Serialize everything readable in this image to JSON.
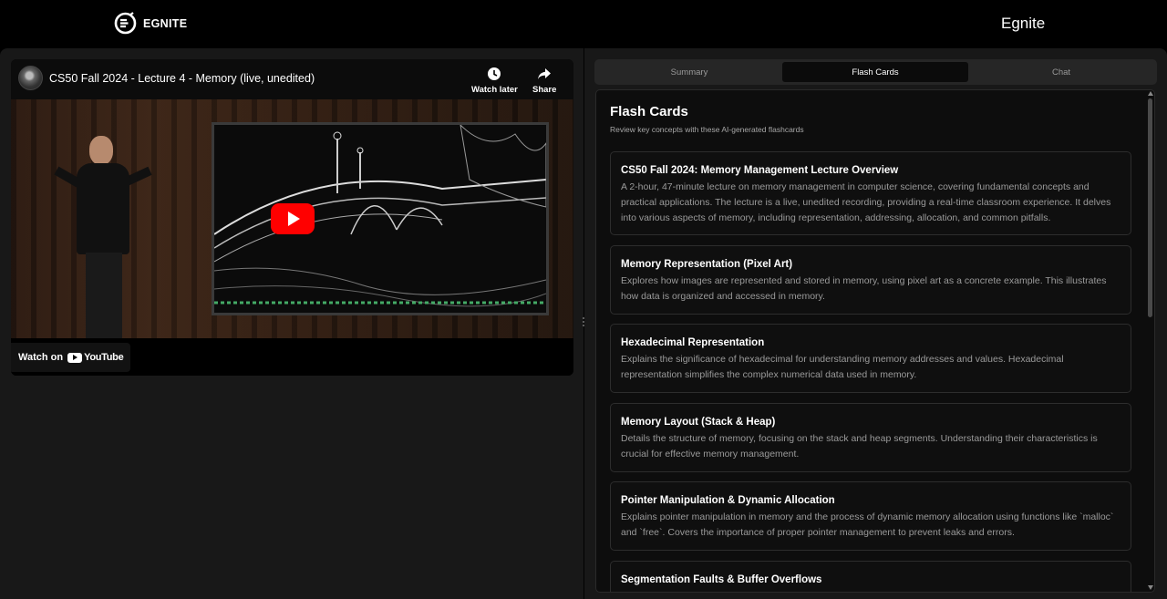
{
  "header": {
    "logo_text": "EGNITE",
    "app_name": "Egnite"
  },
  "video": {
    "title": "CS50 Fall 2024 - Lecture 4 - Memory (live, unedited)",
    "watch_later_label": "Watch later",
    "share_label": "Share",
    "watch_on_label": "Watch on",
    "youtube_label": "YouTube"
  },
  "tabs": [
    {
      "label": "Summary",
      "active": false
    },
    {
      "label": "Flash Cards",
      "active": true
    },
    {
      "label": "Chat",
      "active": false
    }
  ],
  "flashcards": {
    "title": "Flash Cards",
    "subtitle": "Review key concepts with these AI-generated flashcards",
    "cards": [
      {
        "title": "CS50 Fall 2024: Memory Management Lecture Overview",
        "text": "A 2-hour, 47-minute lecture on memory management in computer science, covering fundamental concepts and practical applications. The lecture is a live, unedited recording, providing a real-time classroom experience. It delves into various aspects of memory, including representation, addressing, allocation, and common pitfalls."
      },
      {
        "title": "Memory Representation (Pixel Art)",
        "text": "Explores how images are represented and stored in memory, using pixel art as a concrete example. This illustrates how data is organized and accessed in memory."
      },
      {
        "title": "Hexadecimal Representation",
        "text": "Explains the significance of hexadecimal for understanding memory addresses and values. Hexadecimal representation simplifies the complex numerical data used in memory."
      },
      {
        "title": "Memory Layout (Stack & Heap)",
        "text": "Details the structure of memory, focusing on the stack and heap segments. Understanding their characteristics is crucial for effective memory management."
      },
      {
        "title": "Pointer Manipulation & Dynamic Allocation",
        "text": "Explains pointer manipulation in memory and the process of dynamic memory allocation using functions like `malloc` and `free`. Covers the importance of proper pointer management to prevent leaks and errors."
      },
      {
        "title": "Segmentation Faults & Buffer Overflows",
        "text": ""
      }
    ]
  },
  "colors": {
    "background": "#000000",
    "panel": "#181818",
    "card_border": "#2d2d2d",
    "active_tab": "#0b0b0b",
    "youtube_red": "#ff0000"
  }
}
